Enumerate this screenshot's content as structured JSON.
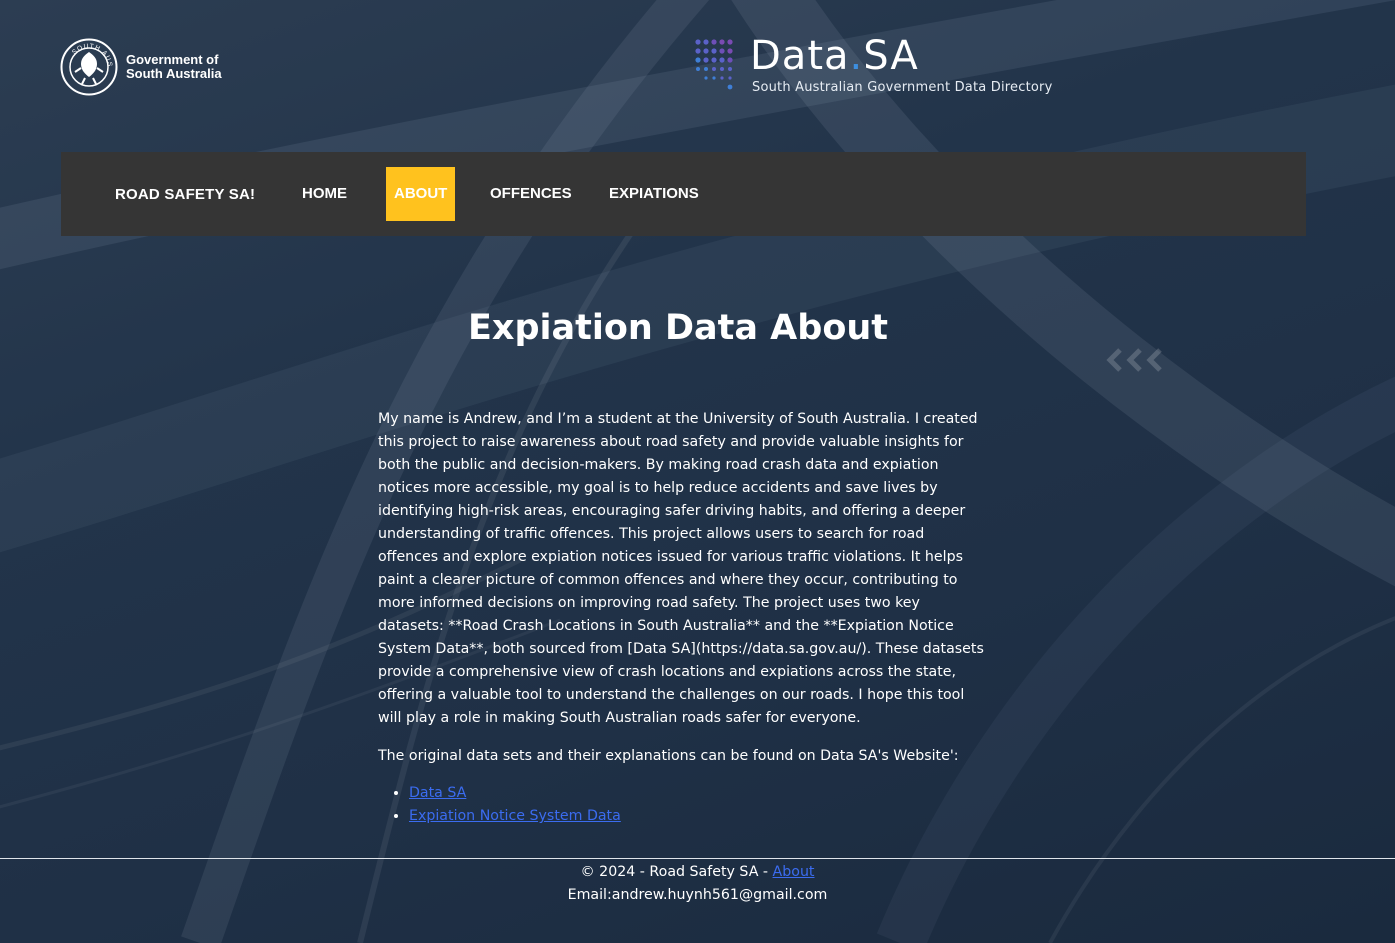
{
  "header": {
    "gov_logo_text_line1": "Government of",
    "gov_logo_text_line2": "South Australia",
    "crest_text": "SOUTH AUSTRALIA",
    "datasa_name_part1": "Data",
    "datasa_name_dot": ".",
    "datasa_name_part2": "SA",
    "datasa_subtitle": "South Australian Government Data Directory"
  },
  "nav": {
    "brand": "ROAD SAFETY SA!",
    "items": [
      {
        "label": "HOME",
        "active": false
      },
      {
        "label": "ABOUT",
        "active": true
      },
      {
        "label": "OFFENCES",
        "active": false
      },
      {
        "label": "EXPIATIONS",
        "active": false
      }
    ]
  },
  "main": {
    "title": "Expiation Data About",
    "paragraph": "My name is Andrew, and I’m a student at the University of South Australia. I created this project to raise awareness about road safety and provide valuable insights for both the public and decision-makers. By making road crash data and expiation notices more accessible, my goal is to help reduce accidents and save lives by identifying high-risk areas, encouraging safer driving habits, and offering a deeper understanding of traffic offences. This project allows users to search for road offences and explore expiation notices issued for various traffic violations. It helps paint a clearer picture of common offences and where they occur, contributing to more informed decisions on improving road safety. The project uses two key datasets: **Road Crash Locations in South Australia** and the **Expiation Notice System Data**, both sourced from [Data SA](https://data.sa.gov.au/). These datasets provide a comprehensive view of crash locations and expiations across the state, offering a valuable tool to understand the challenges on our roads. I hope this tool will play a role in making South Australian roads safer for everyone.",
    "datasets_intro": "The original data sets and their explanations can be found on Data SA's Website':",
    "links": [
      {
        "label": "Data SA"
      },
      {
        "label": "Expiation Notice System Data"
      }
    ]
  },
  "footer": {
    "copyright": "© 2024 - Road Safety SA - ",
    "about_link": "About",
    "email": "Email:andrew.huynh561@gmail.com"
  },
  "colors": {
    "nav_background": "#353535",
    "nav_active": "#ffc21e",
    "link": "#3b6cf0",
    "page_background": "#22344a"
  }
}
